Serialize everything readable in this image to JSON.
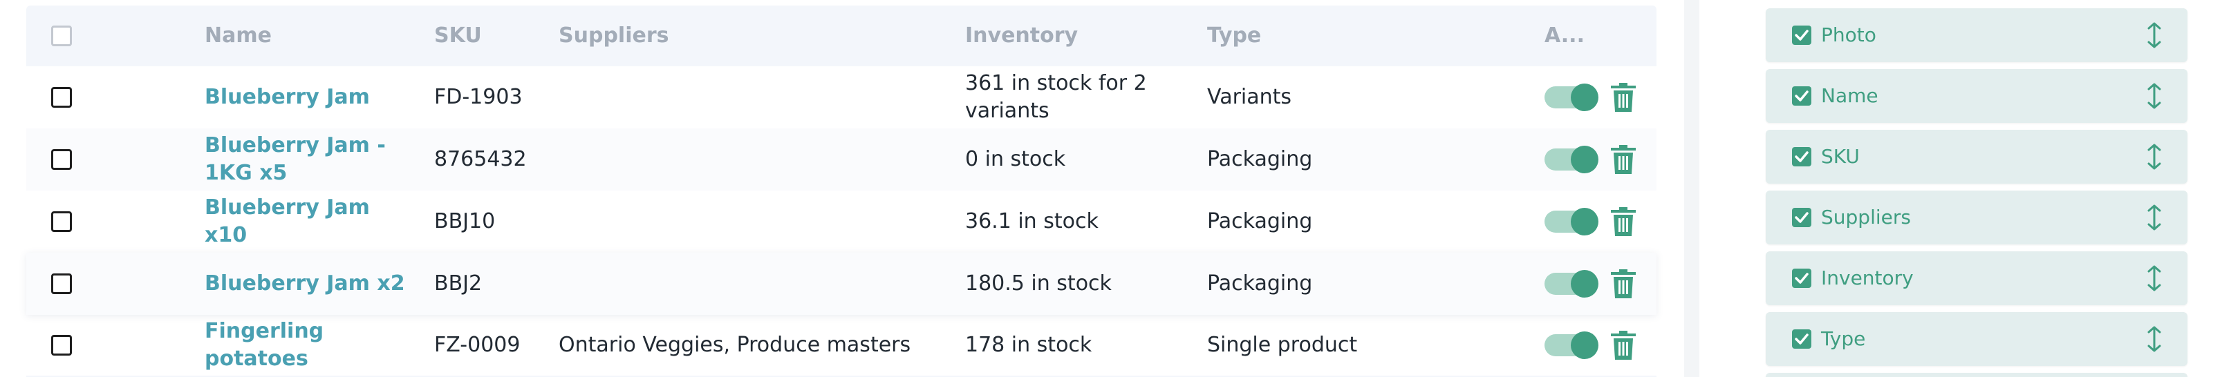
{
  "colors": {
    "accent": "#3f9e81",
    "link": "#4aa0b2",
    "header_bg": "#f3f6fb",
    "header_text": "#a3acb8",
    "panel_item_bg": "#e3eeee"
  },
  "table": {
    "headers": {
      "name": "Name",
      "sku": "SKU",
      "suppliers": "Suppliers",
      "inventory": "Inventory",
      "type": "Type",
      "actions": "A..."
    },
    "rows": [
      {
        "name": "Blueberry Jam",
        "sku": "FD-1903",
        "suppliers": "",
        "inventory": "361 in stock for 2 variants",
        "type": "Variants",
        "active": true
      },
      {
        "name": "Blueberry Jam - 1KG x5",
        "sku": "8765432",
        "suppliers": "",
        "inventory": "0 in stock",
        "type": "Packaging",
        "active": true
      },
      {
        "name": "Blueberry Jam x10",
        "sku": "BBJ10",
        "suppliers": "",
        "inventory": "36.1 in stock",
        "type": "Packaging",
        "active": true
      },
      {
        "name": "Blueberry Jam x2",
        "sku": "BBJ2",
        "suppliers": "",
        "inventory": "180.5 in stock",
        "type": "Packaging",
        "active": true
      },
      {
        "name": "Fingerling potatoes",
        "sku": "FZ-0009",
        "suppliers": "Ontario Veggies, Produce masters",
        "inventory": "178 in stock",
        "type": "Single product",
        "active": true
      }
    ]
  },
  "column_settings": {
    "items": [
      {
        "label": "Photo",
        "checked": true
      },
      {
        "label": "Name",
        "checked": true
      },
      {
        "label": "SKU",
        "checked": true
      },
      {
        "label": "Suppliers",
        "checked": true
      },
      {
        "label": "Inventory",
        "checked": true
      },
      {
        "label": "Type",
        "checked": true
      }
    ]
  }
}
